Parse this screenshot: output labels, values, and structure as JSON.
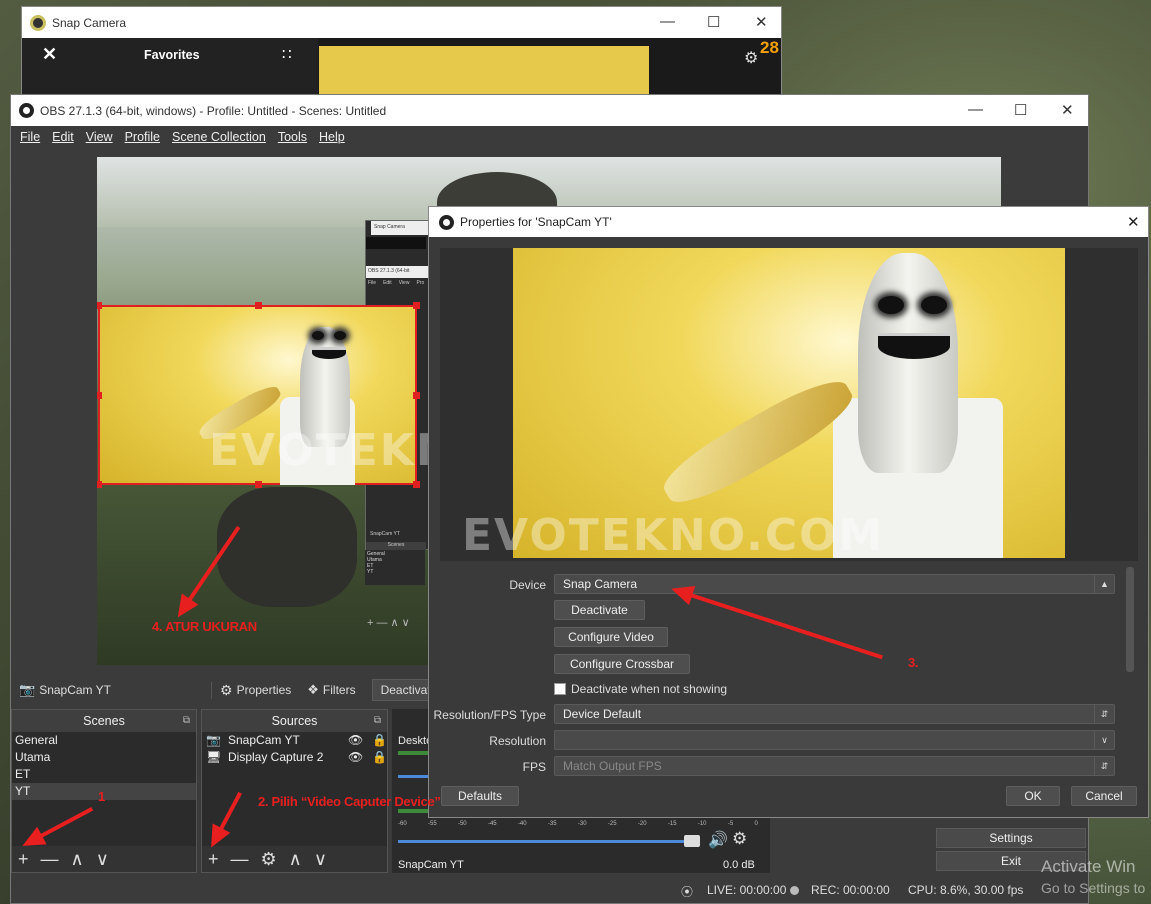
{
  "snap": {
    "title": "Snap Camera",
    "favorites": "Favorites",
    "badge": "28"
  },
  "obs": {
    "title": "OBS 27.1.3 (64-bit, windows) - Profile: Untitled - Scenes: Untitled",
    "menu": [
      "File",
      "Edit",
      "View",
      "Profile",
      "Scene Collection",
      "Tools",
      "Help"
    ],
    "source_name": "SnapCam YT",
    "toolbar": {
      "properties": "Properties",
      "filters": "Filters",
      "deactivate": "Deactivat"
    },
    "scenes": {
      "header": "Scenes",
      "items": [
        "General",
        "Utama",
        "ET",
        "YT"
      ],
      "selected": "YT"
    },
    "sources": {
      "header": "Sources",
      "items": [
        "SnapCam YT",
        "Display Capture 2"
      ]
    },
    "mixer": {
      "desktop_label": "Desktop",
      "ticks": [
        "-60",
        "-55",
        "-50",
        "-45",
        "-40",
        "-35",
        "-30",
        "-25",
        "-20",
        "-15",
        "-10",
        "-5",
        "0"
      ],
      "track_name": "SnapCam YT",
      "db": "0.0 dB"
    },
    "controls": {
      "settings": "Settings",
      "exit": "Exit"
    },
    "status": {
      "live": "LIVE: 00:00:00",
      "rec": "REC: 00:00:00",
      "cpu": "CPU: 8.6%, 30.00 fps"
    },
    "mini": {
      "title": "Snap Camera",
      "obs_title": "OBS 27.1.3 (64-bit",
      "menu": [
        "File",
        "Edit",
        "View",
        "Pro"
      ],
      "source": "SnapCam YT",
      "scenes_header": "Scenes",
      "scene_items": [
        "General",
        "Utama",
        "ET",
        "YT"
      ]
    }
  },
  "props": {
    "title": "Properties for 'SnapCam YT'",
    "device_label": "Device",
    "device_value": "Snap Camera",
    "deactivate": "Deactivate",
    "configure_video": "Configure Video",
    "configure_crossbar": "Configure Crossbar",
    "deactivate_hidden": "Deactivate when not showing",
    "res_type_label": "Resolution/FPS Type",
    "res_type_value": "Device Default",
    "resolution_label": "Resolution",
    "resolution_value": "",
    "fps_label": "FPS",
    "fps_value": "Match Output FPS",
    "defaults": "Defaults",
    "ok": "OK",
    "cancel": "Cancel"
  },
  "annotations": {
    "step1": "1",
    "step2": "2. Pilih “Video Caputer Device”",
    "step3": "3.",
    "step4": "4. ATUR UKURAN",
    "watermark": "EVOTEKNO.COM"
  },
  "windows_watermark": {
    "line1": "Activate Win",
    "line2": "Go to Settings to"
  },
  "colors": {
    "annotation_red": "#e81f1f",
    "obs_bg": "#3b3b3b",
    "camera_yellow": "#f1d85a"
  }
}
